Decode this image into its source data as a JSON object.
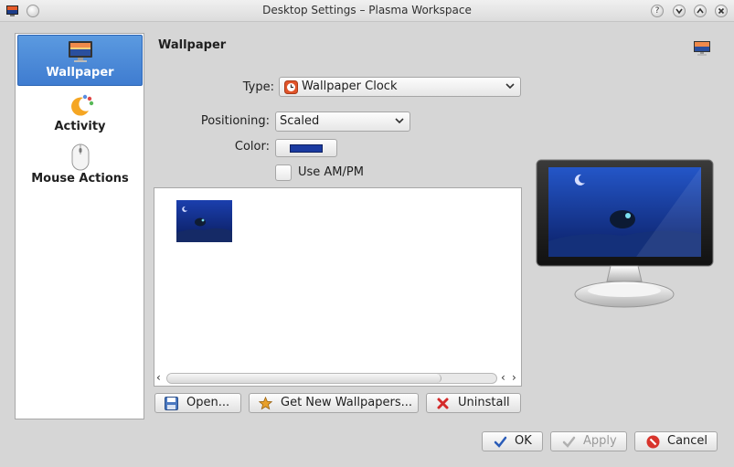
{
  "window": {
    "title": "Desktop Settings – Plasma Workspace",
    "controls": [
      "?",
      "v",
      "^",
      "x"
    ]
  },
  "sidebar": {
    "items": [
      {
        "label": "Wallpaper",
        "icon": "wallpaper-icon",
        "selected": true
      },
      {
        "label": "Activity",
        "icon": "activity-icon",
        "selected": false
      },
      {
        "label": "Mouse Actions",
        "icon": "mouse-icon",
        "selected": false
      }
    ]
  },
  "page": {
    "title": "Wallpaper",
    "type_label": "Type:",
    "type_value": "Wallpaper Clock",
    "positioning_label": "Positioning:",
    "positioning_value": "Scaled",
    "color_label": "Color:",
    "color_value": "#1a3aa0",
    "ampm_label": "Use AM/PM",
    "ampm_checked": false
  },
  "actions": {
    "open": "Open...",
    "get_new": "Get New Wallpapers...",
    "uninstall": "Uninstall"
  },
  "footer": {
    "ok": "OK",
    "apply": "Apply",
    "cancel": "Cancel"
  }
}
